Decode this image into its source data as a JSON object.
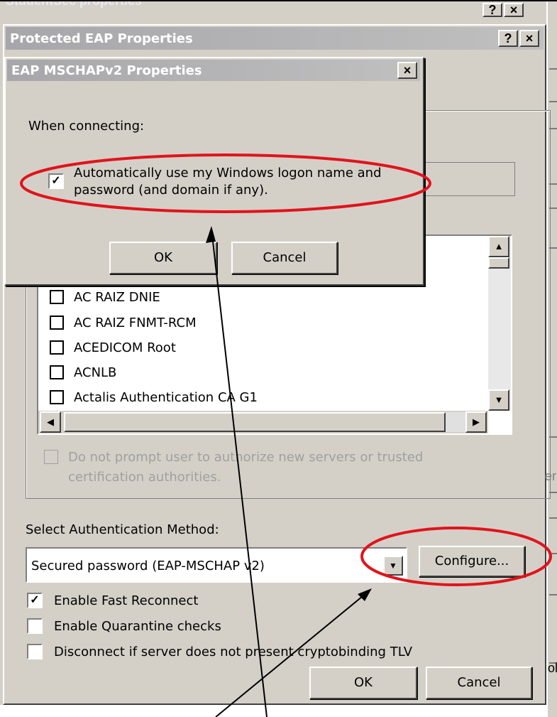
{
  "background_dialog": {
    "title": "StudentSec properties"
  },
  "peap_dialog": {
    "title": "Protected EAP Properties",
    "help_button": "?",
    "close_button": "×",
    "trusted_roots": [
      {
        "label": "AC RAIZ DNIE",
        "checked": false
      },
      {
        "label": "AC RAIZ FNMT-RCM",
        "checked": false
      },
      {
        "label": "ACEDICOM Root",
        "checked": false
      },
      {
        "label": "ACNLB",
        "checked": false
      },
      {
        "label": "Actalis Authentication CA G1",
        "checked": false
      }
    ],
    "do_not_prompt_line1": "Do not prompt user to authorize new servers or trusted",
    "do_not_prompt_line2": "certification authorities.",
    "select_auth_label": "Select Authentication Method:",
    "auth_method_value": "Secured password (EAP-MSCHAP v2)",
    "configure_button": "Configure...",
    "enable_fast_reconnect": {
      "label": "Enable Fast Reconnect",
      "checked": true
    },
    "enable_quarantine": {
      "label": "Enable Quarantine checks",
      "checked": false
    },
    "disconnect_cryptobinding": {
      "label": "Disconnect if server does not present cryptobinding TLV",
      "checked": false
    },
    "ok_button": "OK",
    "cancel_button": "Cancel"
  },
  "mschap_dialog": {
    "title": "EAP MSCHAPv2 Properties",
    "close_button": "×",
    "when_connecting": "When connecting:",
    "auto_logon_line1": "Automatically use my Windows logon name and",
    "auto_logon_line2": "password (and domain if any).",
    "auto_logon_checked": true,
    "ok_button": "OK",
    "cancel_button": "Cancel"
  },
  "colors": {
    "annotation": "#e0141c",
    "dialog_face": "#d4d0c8",
    "title_gradient": "#a7a6aa"
  }
}
